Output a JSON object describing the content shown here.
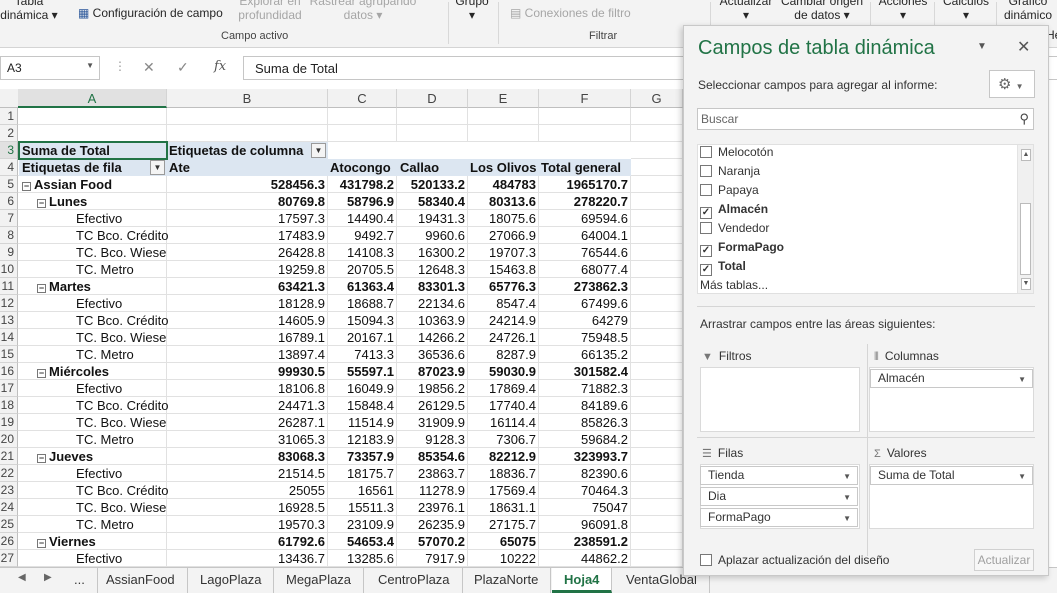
{
  "ribbon": {
    "items": [
      {
        "label": "Tabla\ndinámica ▾",
        "disabled": false
      },
      {
        "label": "Configuración de campo",
        "disabled": false
      },
      {
        "label": "Explorar en\nprofundidad",
        "disabled": true
      },
      {
        "label": "Rastrear agrupando\ndatos ▾",
        "disabled": true
      },
      {
        "label": "Grupo\n▾",
        "disabled": false
      },
      {
        "label": "Conexiones de filtro",
        "disabled": true
      },
      {
        "label": "Actualizar\n▾",
        "disabled": false
      },
      {
        "label": "Cambiar origen\nde datos ▾",
        "disabled": false
      },
      {
        "label": "Acciones\n▾",
        "disabled": false
      },
      {
        "label": "Cálculos\n▾",
        "disabled": false
      },
      {
        "label": "Gráfico\ndinámico",
        "disabled": false
      },
      {
        "label": "He",
        "disabled": false
      }
    ],
    "groups": {
      "active_field": "Campo activo",
      "filter": "Filtrar"
    }
  },
  "formula_bar": {
    "name_box": "A3",
    "cancel": "✕",
    "confirm": "✓",
    "fx": "fx",
    "content": "Suma de Total"
  },
  "columns": [
    "A",
    "B",
    "C",
    "D",
    "E",
    "F",
    "G"
  ],
  "rows": [
    "1",
    "2",
    "3",
    "4",
    "5",
    "6",
    "7",
    "8",
    "9",
    "10",
    "11",
    "12",
    "13",
    "14",
    "15",
    "16",
    "17",
    "18",
    "19",
    "20",
    "21",
    "22",
    "23",
    "24",
    "25",
    "26",
    "27"
  ],
  "pivot": {
    "value_label": "Suma de Total",
    "col_labels_caption": "Etiquetas de columna",
    "row_labels_caption": "Etiquetas de fila",
    "col_headers": [
      "Ate",
      "Atocongo",
      "Callao",
      "Los Olivos",
      "Total general"
    ],
    "data_rows": [
      {
        "label": "Assian Food",
        "level": 0,
        "bold": true,
        "toggle": true,
        "values": [
          "528456.3",
          "431798.2",
          "520133.2",
          "484783",
          "1965170.7"
        ]
      },
      {
        "label": "Lunes",
        "level": 1,
        "bold": true,
        "toggle": true,
        "values": [
          "80769.8",
          "58796.9",
          "58340.4",
          "80313.6",
          "278220.7"
        ]
      },
      {
        "label": "Efectivo",
        "level": 2,
        "bold": false,
        "toggle": false,
        "values": [
          "17597.3",
          "14490.4",
          "19431.3",
          "18075.6",
          "69594.6"
        ]
      },
      {
        "label": "TC Bco. Crédito",
        "level": 2,
        "bold": false,
        "toggle": false,
        "values": [
          "17483.9",
          "9492.7",
          "9960.6",
          "27066.9",
          "64004.1"
        ]
      },
      {
        "label": "TC. Bco. Wiese",
        "level": 2,
        "bold": false,
        "toggle": false,
        "values": [
          "26428.8",
          "14108.3",
          "16300.2",
          "19707.3",
          "76544.6"
        ]
      },
      {
        "label": "TC. Metro",
        "level": 2,
        "bold": false,
        "toggle": false,
        "values": [
          "19259.8",
          "20705.5",
          "12648.3",
          "15463.8",
          "68077.4"
        ]
      },
      {
        "label": "Martes",
        "level": 1,
        "bold": true,
        "toggle": true,
        "values": [
          "63421.3",
          "61363.4",
          "83301.3",
          "65776.3",
          "273862.3"
        ]
      },
      {
        "label": "Efectivo",
        "level": 2,
        "bold": false,
        "toggle": false,
        "values": [
          "18128.9",
          "18688.7",
          "22134.6",
          "8547.4",
          "67499.6"
        ]
      },
      {
        "label": "TC Bco. Crédito",
        "level": 2,
        "bold": false,
        "toggle": false,
        "values": [
          "14605.9",
          "15094.3",
          "10363.9",
          "24214.9",
          "64279"
        ]
      },
      {
        "label": "TC. Bco. Wiese",
        "level": 2,
        "bold": false,
        "toggle": false,
        "values": [
          "16789.1",
          "20167.1",
          "14266.2",
          "24726.1",
          "75948.5"
        ]
      },
      {
        "label": "TC. Metro",
        "level": 2,
        "bold": false,
        "toggle": false,
        "values": [
          "13897.4",
          "7413.3",
          "36536.6",
          "8287.9",
          "66135.2"
        ]
      },
      {
        "label": "Miércoles",
        "level": 1,
        "bold": true,
        "toggle": true,
        "values": [
          "99930.5",
          "55597.1",
          "87023.9",
          "59030.9",
          "301582.4"
        ]
      },
      {
        "label": "Efectivo",
        "level": 2,
        "bold": false,
        "toggle": false,
        "values": [
          "18106.8",
          "16049.9",
          "19856.2",
          "17869.4",
          "71882.3"
        ]
      },
      {
        "label": "TC Bco. Crédito",
        "level": 2,
        "bold": false,
        "toggle": false,
        "values": [
          "24471.3",
          "15848.4",
          "26129.5",
          "17740.4",
          "84189.6"
        ]
      },
      {
        "label": "TC. Bco. Wiese",
        "level": 2,
        "bold": false,
        "toggle": false,
        "values": [
          "26287.1",
          "11514.9",
          "31909.9",
          "16114.4",
          "85826.3"
        ]
      },
      {
        "label": "TC. Metro",
        "level": 2,
        "bold": false,
        "toggle": false,
        "values": [
          "31065.3",
          "12183.9",
          "9128.3",
          "7306.7",
          "59684.2"
        ]
      },
      {
        "label": "Jueves",
        "level": 1,
        "bold": true,
        "toggle": true,
        "values": [
          "83068.3",
          "73357.9",
          "85354.6",
          "82212.9",
          "323993.7"
        ]
      },
      {
        "label": "Efectivo",
        "level": 2,
        "bold": false,
        "toggle": false,
        "values": [
          "21514.5",
          "18175.7",
          "23863.7",
          "18836.7",
          "82390.6"
        ]
      },
      {
        "label": "TC Bco. Crédito",
        "level": 2,
        "bold": false,
        "toggle": false,
        "values": [
          "25055",
          "16561",
          "11278.9",
          "17569.4",
          "70464.3"
        ]
      },
      {
        "label": "TC. Bco. Wiese",
        "level": 2,
        "bold": false,
        "toggle": false,
        "values": [
          "16928.5",
          "15511.3",
          "23976.1",
          "18631.1",
          "75047"
        ]
      },
      {
        "label": "TC. Metro",
        "level": 2,
        "bold": false,
        "toggle": false,
        "values": [
          "19570.3",
          "23109.9",
          "26235.9",
          "27175.7",
          "96091.8"
        ]
      },
      {
        "label": "Viernes",
        "level": 1,
        "bold": true,
        "toggle": true,
        "values": [
          "61792.6",
          "54653.4",
          "57070.2",
          "65075",
          "238591.2"
        ]
      },
      {
        "label": "Efectivo",
        "level": 2,
        "bold": false,
        "toggle": false,
        "values": [
          "13436.7",
          "13285.6",
          "7917.9",
          "10222",
          "44862.2"
        ]
      }
    ]
  },
  "sheet_tabs": {
    "more": "...",
    "tabs": [
      {
        "label": "AssianFood",
        "active": false
      },
      {
        "label": "LagoPlaza",
        "active": false
      },
      {
        "label": "MegaPlaza",
        "active": false
      },
      {
        "label": "CentroPlaza",
        "active": false
      },
      {
        "label": "PlazaNorte",
        "active": false
      },
      {
        "label": "Hoja4",
        "active": true
      },
      {
        "label": "VentaGlobal",
        "active": false
      }
    ]
  },
  "pane": {
    "title": "Campos de tabla dinámica",
    "subtitle": "Seleccionar campos para agregar al informe:",
    "search_placeholder": "Buscar",
    "fields": [
      {
        "label": "Melocotón",
        "checked": false
      },
      {
        "label": "Naranja",
        "checked": false
      },
      {
        "label": "Papaya",
        "checked": false
      },
      {
        "label": "Almacén",
        "checked": true
      },
      {
        "label": "Vendedor",
        "checked": false
      },
      {
        "label": "FormaPago",
        "checked": true
      },
      {
        "label": "Total",
        "checked": true
      },
      {
        "label": "Más tablas...",
        "checked": null
      }
    ],
    "drag_label": "Arrastrar campos entre las áreas siguientes:",
    "areas": {
      "filters": {
        "title": "Filtros",
        "items": []
      },
      "columns": {
        "title": "Columnas",
        "items": [
          "Almacén"
        ]
      },
      "rows": {
        "title": "Filas",
        "items": [
          "Tienda",
          "Dia",
          "FormaPago"
        ]
      },
      "values": {
        "title": "Valores",
        "items": [
          "Suma de Total"
        ]
      }
    },
    "defer_label": "Aplazar actualización del diseño",
    "update_label": "Actualizar"
  },
  "colors": {
    "excel_green": "#217346",
    "pivot_header_fill": "#dce6f1"
  }
}
